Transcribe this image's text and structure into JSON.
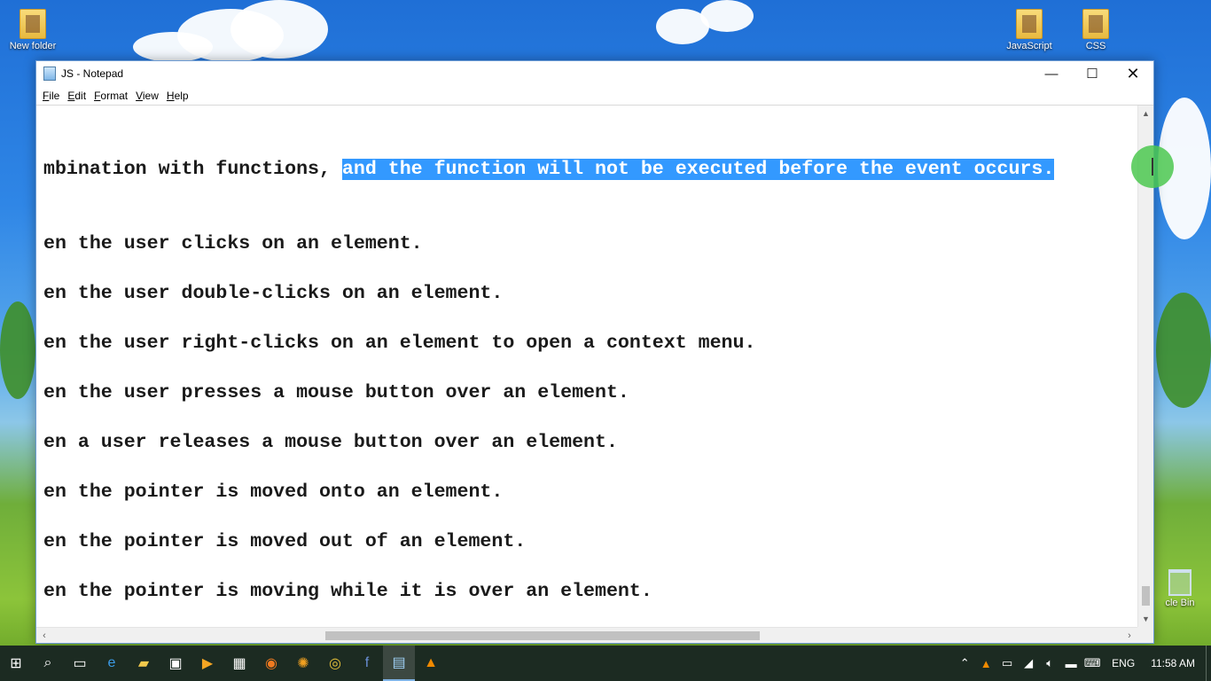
{
  "desktop": {
    "icons": [
      {
        "label": "New folder",
        "icon": "folder-icon"
      },
      {
        "label": "JavaScript",
        "icon": "folder-icon"
      },
      {
        "label": "CSS",
        "icon": "folder-icon"
      },
      {
        "label": "cle Bin",
        "icon": "recycle-bin-icon"
      }
    ]
  },
  "window": {
    "title": "JS - Notepad",
    "controls": {
      "minimize": "—",
      "maximize": "☐",
      "close": "✕"
    },
    "menu": [
      {
        "key": "F",
        "rest": "ile"
      },
      {
        "key": "E",
        "rest": "dit"
      },
      {
        "key": "F",
        "rest": "ormat"
      },
      {
        "key": "V",
        "rest": "iew"
      },
      {
        "key": "H",
        "rest": "elp"
      }
    ]
  },
  "editor": {
    "lines": [
      {
        "plain": "mbination with functions, ",
        "selected": "and the function will not be executed before the event occurs."
      },
      {
        "plain": "en the user clicks on an element.",
        "selected": ""
      },
      {
        "plain": "en the user double-clicks on an element.",
        "selected": ""
      },
      {
        "plain": "en the user right-clicks on an element to open a context menu.",
        "selected": ""
      },
      {
        "plain": "en the user presses a mouse button over an element.",
        "selected": ""
      },
      {
        "plain": "en a user releases a mouse button over an element.",
        "selected": ""
      },
      {
        "plain": "en the pointer is moved onto an element.",
        "selected": ""
      },
      {
        "plain": "en the pointer is moved out of an element.",
        "selected": ""
      },
      {
        "plain": "en the pointer is moving while it is over an element.",
        "selected": ""
      }
    ]
  },
  "taskbar": {
    "language": "ENG",
    "time": "11:58 AM"
  },
  "colors": {
    "selection": "#3399ff",
    "taskbar": "#1c2b22",
    "cursor_highlight": "#4cc850"
  }
}
